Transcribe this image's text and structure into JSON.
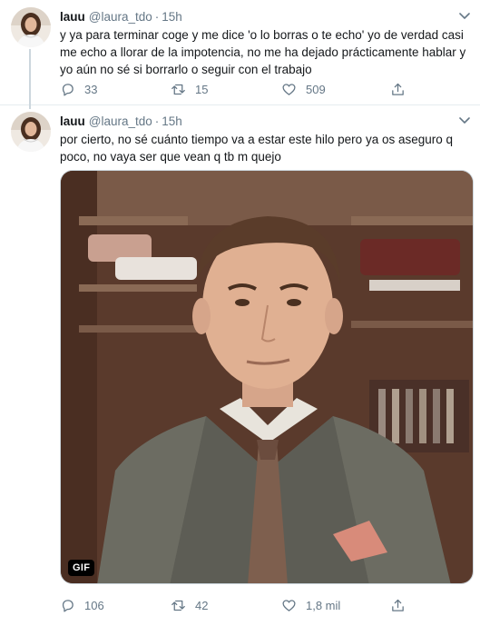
{
  "tweets": [
    {
      "name": "lauu",
      "handle": "@laura_tdo",
      "separator": "·",
      "time": "15h",
      "text": "y ya para terminar coge y me dice 'o lo borras o te echo' yo de verdad casi me echo a llorar de la impotencia, no me ha dejado prácticamente hablar y yo aún no sé si borrarlo o seguir con el trabajo",
      "replies": "33",
      "retweets": "15",
      "likes": "509"
    },
    {
      "name": "lauu",
      "handle": "@laura_tdo",
      "separator": "·",
      "time": "15h",
      "text": "por cierto, no sé cuánto tiempo va a estar este hilo pero ya os aseguro q poco, no vaya ser que vean q tb m quejo",
      "media_badge": "GIF",
      "replies": "106",
      "retweets": "42",
      "likes": "1,8 mil"
    }
  ],
  "icons": {
    "reply": "reply-icon",
    "retweet": "retweet-icon",
    "like": "heart-icon",
    "share": "share-icon",
    "menu": "chevron-down-icon"
  },
  "colors": {
    "text": "#14171a",
    "secondary": "#657786",
    "border": "#e6ecf0",
    "thread_line": "#ccd6dd"
  }
}
